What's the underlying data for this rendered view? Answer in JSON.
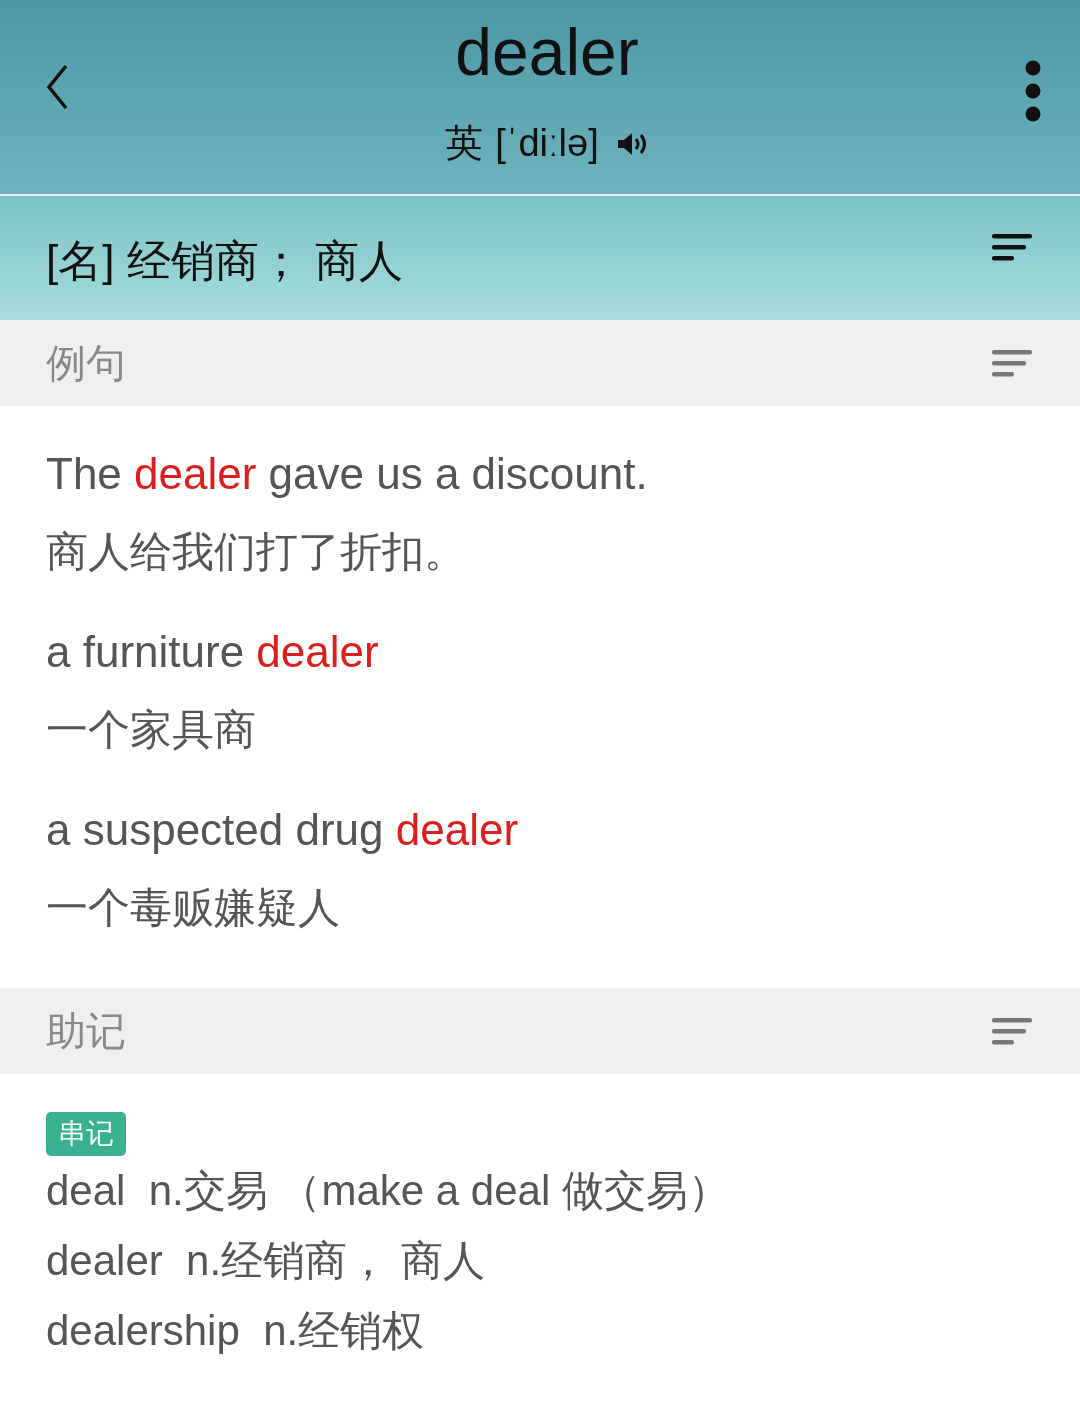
{
  "header": {
    "word": "dealer",
    "accent": "英",
    "phonetic": "[ˈdiːlə]"
  },
  "definition": "[名] 经销商； 商人",
  "sections": [
    {
      "title": "例句",
      "kind": "examples",
      "examples": [
        {
          "english": [
            {
              "text": "The ",
              "highlight": false
            },
            {
              "text": "dealer",
              "highlight": true
            },
            {
              "text": " gave us a discount.",
              "highlight": false
            }
          ],
          "chinese": "商人给我们打了折扣。"
        },
        {
          "english": [
            {
              "text": "a furniture ",
              "highlight": false
            },
            {
              "text": "dealer",
              "highlight": true
            }
          ],
          "chinese": "一个家具商"
        },
        {
          "english": [
            {
              "text": "a suspected drug ",
              "highlight": false
            },
            {
              "text": "dealer",
              "highlight": true
            }
          ],
          "chinese": "一个毒贩嫌疑人"
        }
      ]
    },
    {
      "title": "助记",
      "kind": "mnemonic",
      "tag": "串记",
      "lines": [
        "deal  n.交易 （make a deal 做交易）",
        "dealer  n.经销商， 商人",
        "dealership  n.经销权"
      ]
    }
  ]
}
